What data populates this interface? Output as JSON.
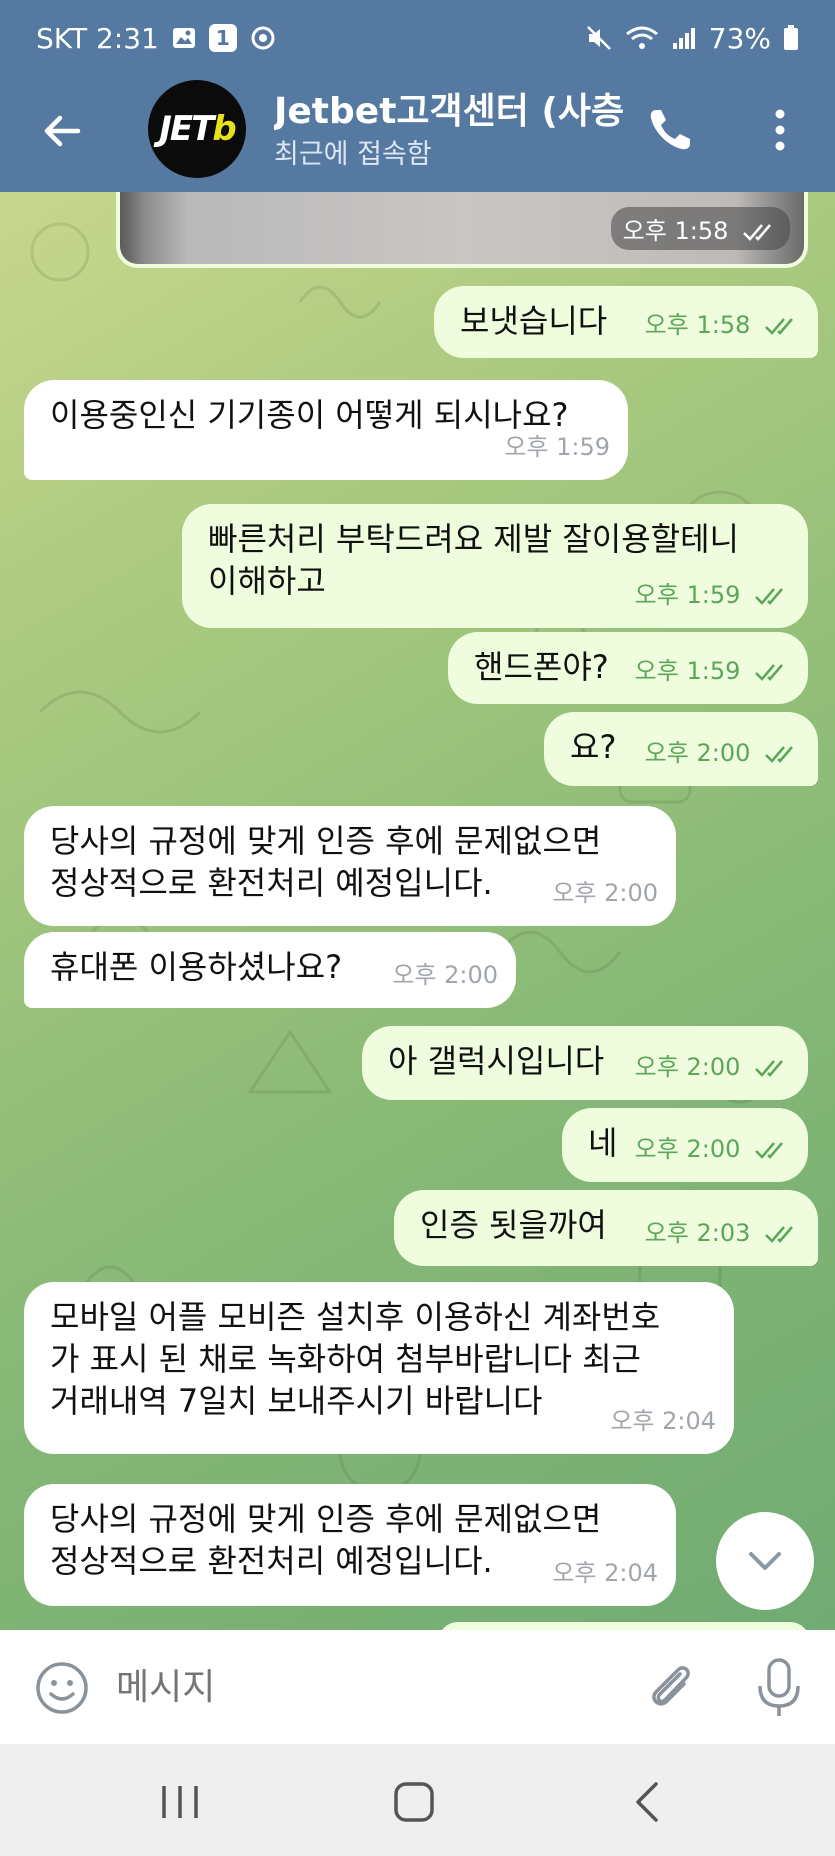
{
  "status_bar": {
    "carrier_time": "SKT 2:31",
    "notification_count": "1",
    "battery": "73%"
  },
  "header": {
    "title": "Jetbet고객센터 (사층",
    "subtitle": "최근에 접속함",
    "avatar_text_main": "JET",
    "avatar_text_accent": "b"
  },
  "messages": [
    {
      "id": "m0",
      "dir": "out",
      "type": "media",
      "time": "오후 1:58"
    },
    {
      "id": "m1",
      "dir": "out",
      "lines": [
        "보냇습니다"
      ],
      "time": "오후 1:58"
    },
    {
      "id": "m2",
      "dir": "in",
      "lines": [
        "이용중인신 기기종이 어떻게 되시나요?"
      ],
      "time": "오후 1:59"
    },
    {
      "id": "m3",
      "dir": "out",
      "lines": [
        "빠른처리 부탁드려요 제발 잘이용할테니",
        "이해하고"
      ],
      "time": "오후 1:59"
    },
    {
      "id": "m4",
      "dir": "out",
      "lines": [
        "핸드폰야?"
      ],
      "time": "오후 1:59"
    },
    {
      "id": "m5",
      "dir": "out",
      "lines": [
        "요?"
      ],
      "time": "오후 2:00"
    },
    {
      "id": "m6",
      "dir": "in",
      "lines": [
        "당사의 규정에 맞게 인증 후에 문제없으면",
        "정상적으로 환전처리 예정입니다."
      ],
      "time": "오후 2:00"
    },
    {
      "id": "m7",
      "dir": "in",
      "lines": [
        "휴대폰 이용하셨나요?"
      ],
      "time": "오후 2:00"
    },
    {
      "id": "m8",
      "dir": "out",
      "lines": [
        "아 갤럭시입니다"
      ],
      "time": "오후 2:00"
    },
    {
      "id": "m9",
      "dir": "out",
      "lines": [
        "네"
      ],
      "time": "오후 2:00"
    },
    {
      "id": "m10",
      "dir": "out",
      "lines": [
        "인증 됫을까여"
      ],
      "time": "오후 2:03"
    },
    {
      "id": "m11",
      "dir": "in",
      "lines": [
        "모바일 어플 모비즌 설치후 이용하신 계좌번호",
        "가 표시 된 채로 녹화하여 첨부바랍니다  최근",
        "거래내역 7일치 보내주시기 바랍니다"
      ],
      "time": "오후 2:04"
    },
    {
      "id": "m12",
      "dir": "in",
      "lines": [
        "당사의 규정에 맞게 인증 후에 문제없으면",
        "정상적으로 환전처리 예정입니다."
      ],
      "time": "오후 2:04"
    }
  ],
  "input": {
    "placeholder": "메시지"
  },
  "icons": {
    "back": "back-arrow-icon",
    "call": "phone-icon",
    "menu": "more-vertical-icon",
    "emoji": "emoji-icon",
    "attach": "paperclip-icon",
    "mic": "microphone-icon",
    "scroll": "chevron-down-icon"
  },
  "colors": {
    "header": "#5679a1",
    "outgoing_bubble": "#effdde",
    "incoming_bubble": "#ffffff",
    "outgoing_meta": "#5ba659"
  }
}
